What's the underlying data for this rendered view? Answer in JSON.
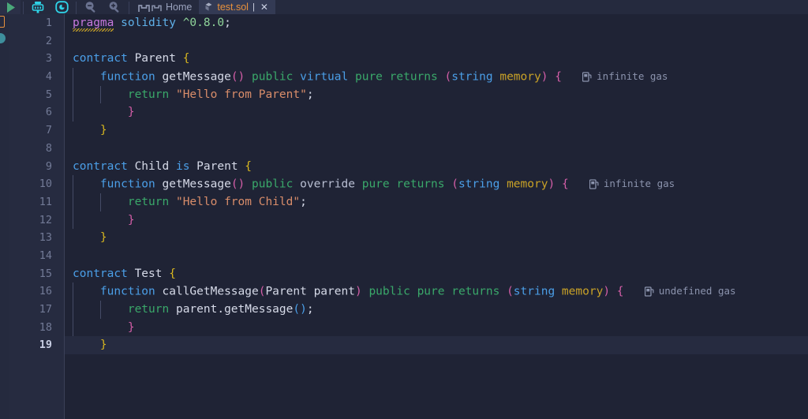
{
  "window": {
    "app": "remix-ide-solidity-editor",
    "background": "#1f2335",
    "gutter_background": "#262b40",
    "accent": "#e8913c"
  },
  "toolbar": {
    "buttons": [
      {
        "name": "run-icon",
        "label": "",
        "color": "#4aa87a"
      },
      {
        "name": "compile-icon",
        "label": "",
        "color": "#2fd4e8"
      },
      {
        "name": "deploy-icon",
        "label": "",
        "color": "#2fd4e8"
      },
      {
        "name": "zoom-out-icon",
        "label": "",
        "color": "#6a7290"
      },
      {
        "name": "zoom-in-icon",
        "label": "",
        "color": "#6a7290"
      },
      {
        "name": "home-icon",
        "label": "",
        "color": "#8b93ad"
      }
    ]
  },
  "tabs": [
    {
      "label": "Home",
      "icon": "home-icon",
      "active": false,
      "modified": "",
      "closable": false
    },
    {
      "label": "test.sol",
      "icon": "solidity-icon",
      "active": true,
      "modified": "|",
      "closable": true,
      "close_glyph": "✕"
    }
  ],
  "left_strip": {
    "icons": [
      {
        "name": "file-explorer-icon",
        "color": "#e8913c"
      },
      {
        "name": "solidity-compiler-icon",
        "color": "#3e8f9c"
      }
    ]
  },
  "editor": {
    "filename": "test.sol",
    "language": "solidity",
    "current_line": 19,
    "total_lines": 19,
    "line_numbers": [
      1,
      2,
      3,
      4,
      5,
      6,
      7,
      8,
      9,
      10,
      11,
      12,
      13,
      14,
      15,
      16,
      17,
      18,
      19
    ],
    "lines": [
      {
        "n": 1,
        "text": "pragma solidity ^0.8.0;"
      },
      {
        "n": 2,
        "text": ""
      },
      {
        "n": 3,
        "text": "contract Parent {"
      },
      {
        "n": 4,
        "text": "    function getMessage() public virtual pure returns (string memory) {"
      },
      {
        "n": 5,
        "text": "        return \"Hello from Parent\";"
      },
      {
        "n": 6,
        "text": "        }"
      },
      {
        "n": 7,
        "text": "    }"
      },
      {
        "n": 8,
        "text": ""
      },
      {
        "n": 9,
        "text": "contract Child is Parent {"
      },
      {
        "n": 10,
        "text": "    function getMessage() public override pure returns (string memory) {"
      },
      {
        "n": 11,
        "text": "        return \"Hello from Child\";"
      },
      {
        "n": 12,
        "text": "        }"
      },
      {
        "n": 13,
        "text": "    }"
      },
      {
        "n": 14,
        "text": ""
      },
      {
        "n": 15,
        "text": "contract Test {"
      },
      {
        "n": 16,
        "text": "    function callGetMessage(Parent parent) public pure returns (string memory) {"
      },
      {
        "n": 17,
        "text": "        return parent.getMessage();"
      },
      {
        "n": 18,
        "text": "        }"
      },
      {
        "n": 19,
        "text": "    }"
      }
    ],
    "tokens": {
      "pragma": "pragma",
      "solidity": "solidity",
      "version": "^0.8.0",
      "semicolon": ";",
      "contract": "contract",
      "function": "function",
      "is": "is",
      "public": "public",
      "virtual": "virtual",
      "override": "override",
      "pure": "pure",
      "returns": "returns",
      "return": "return",
      "string": "string",
      "memory": "memory",
      "parent_type": "Parent",
      "parent_param": "parent",
      "name_parent": "Parent",
      "name_child": "Child",
      "name_test": "Test",
      "fn_getmessage": "getMessage",
      "fn_callgetmessage": "callGetMessage",
      "str_parent": "\"Hello from Parent\"",
      "str_child": "\"Hello from Child\"",
      "call_expr": "parent.getMessage",
      "paren_open": "(",
      "paren_close": ")",
      "brace_open": "{",
      "brace_close": "}",
      "dot": "."
    },
    "gas_annotations": [
      {
        "line": 4,
        "icon": "gas-pump-icon",
        "text": "infinite gas"
      },
      {
        "line": 10,
        "icon": "gas-pump-icon",
        "text": "infinite gas"
      },
      {
        "line": 16,
        "icon": "gas-pump-icon",
        "text": "undefined gas"
      }
    ],
    "diagnostics": [
      {
        "line": 1,
        "token": "pragma",
        "kind": "warning-squiggle",
        "color": "#c9a227"
      }
    ]
  },
  "colors": {
    "keyword_purple": "#c678dd",
    "keyword_blue": "#4b9fe8",
    "keyword_green": "#3aa86a",
    "identifier": "#d6dae8",
    "string": "#d98d6a",
    "number": "#8fd49a",
    "memory_gold": "#c9a227",
    "brace_yellow": "#d7b61f",
    "brace_magenta": "#d45ea8",
    "gutter_number": "#727a96",
    "gas_text": "#8b93ad"
  }
}
